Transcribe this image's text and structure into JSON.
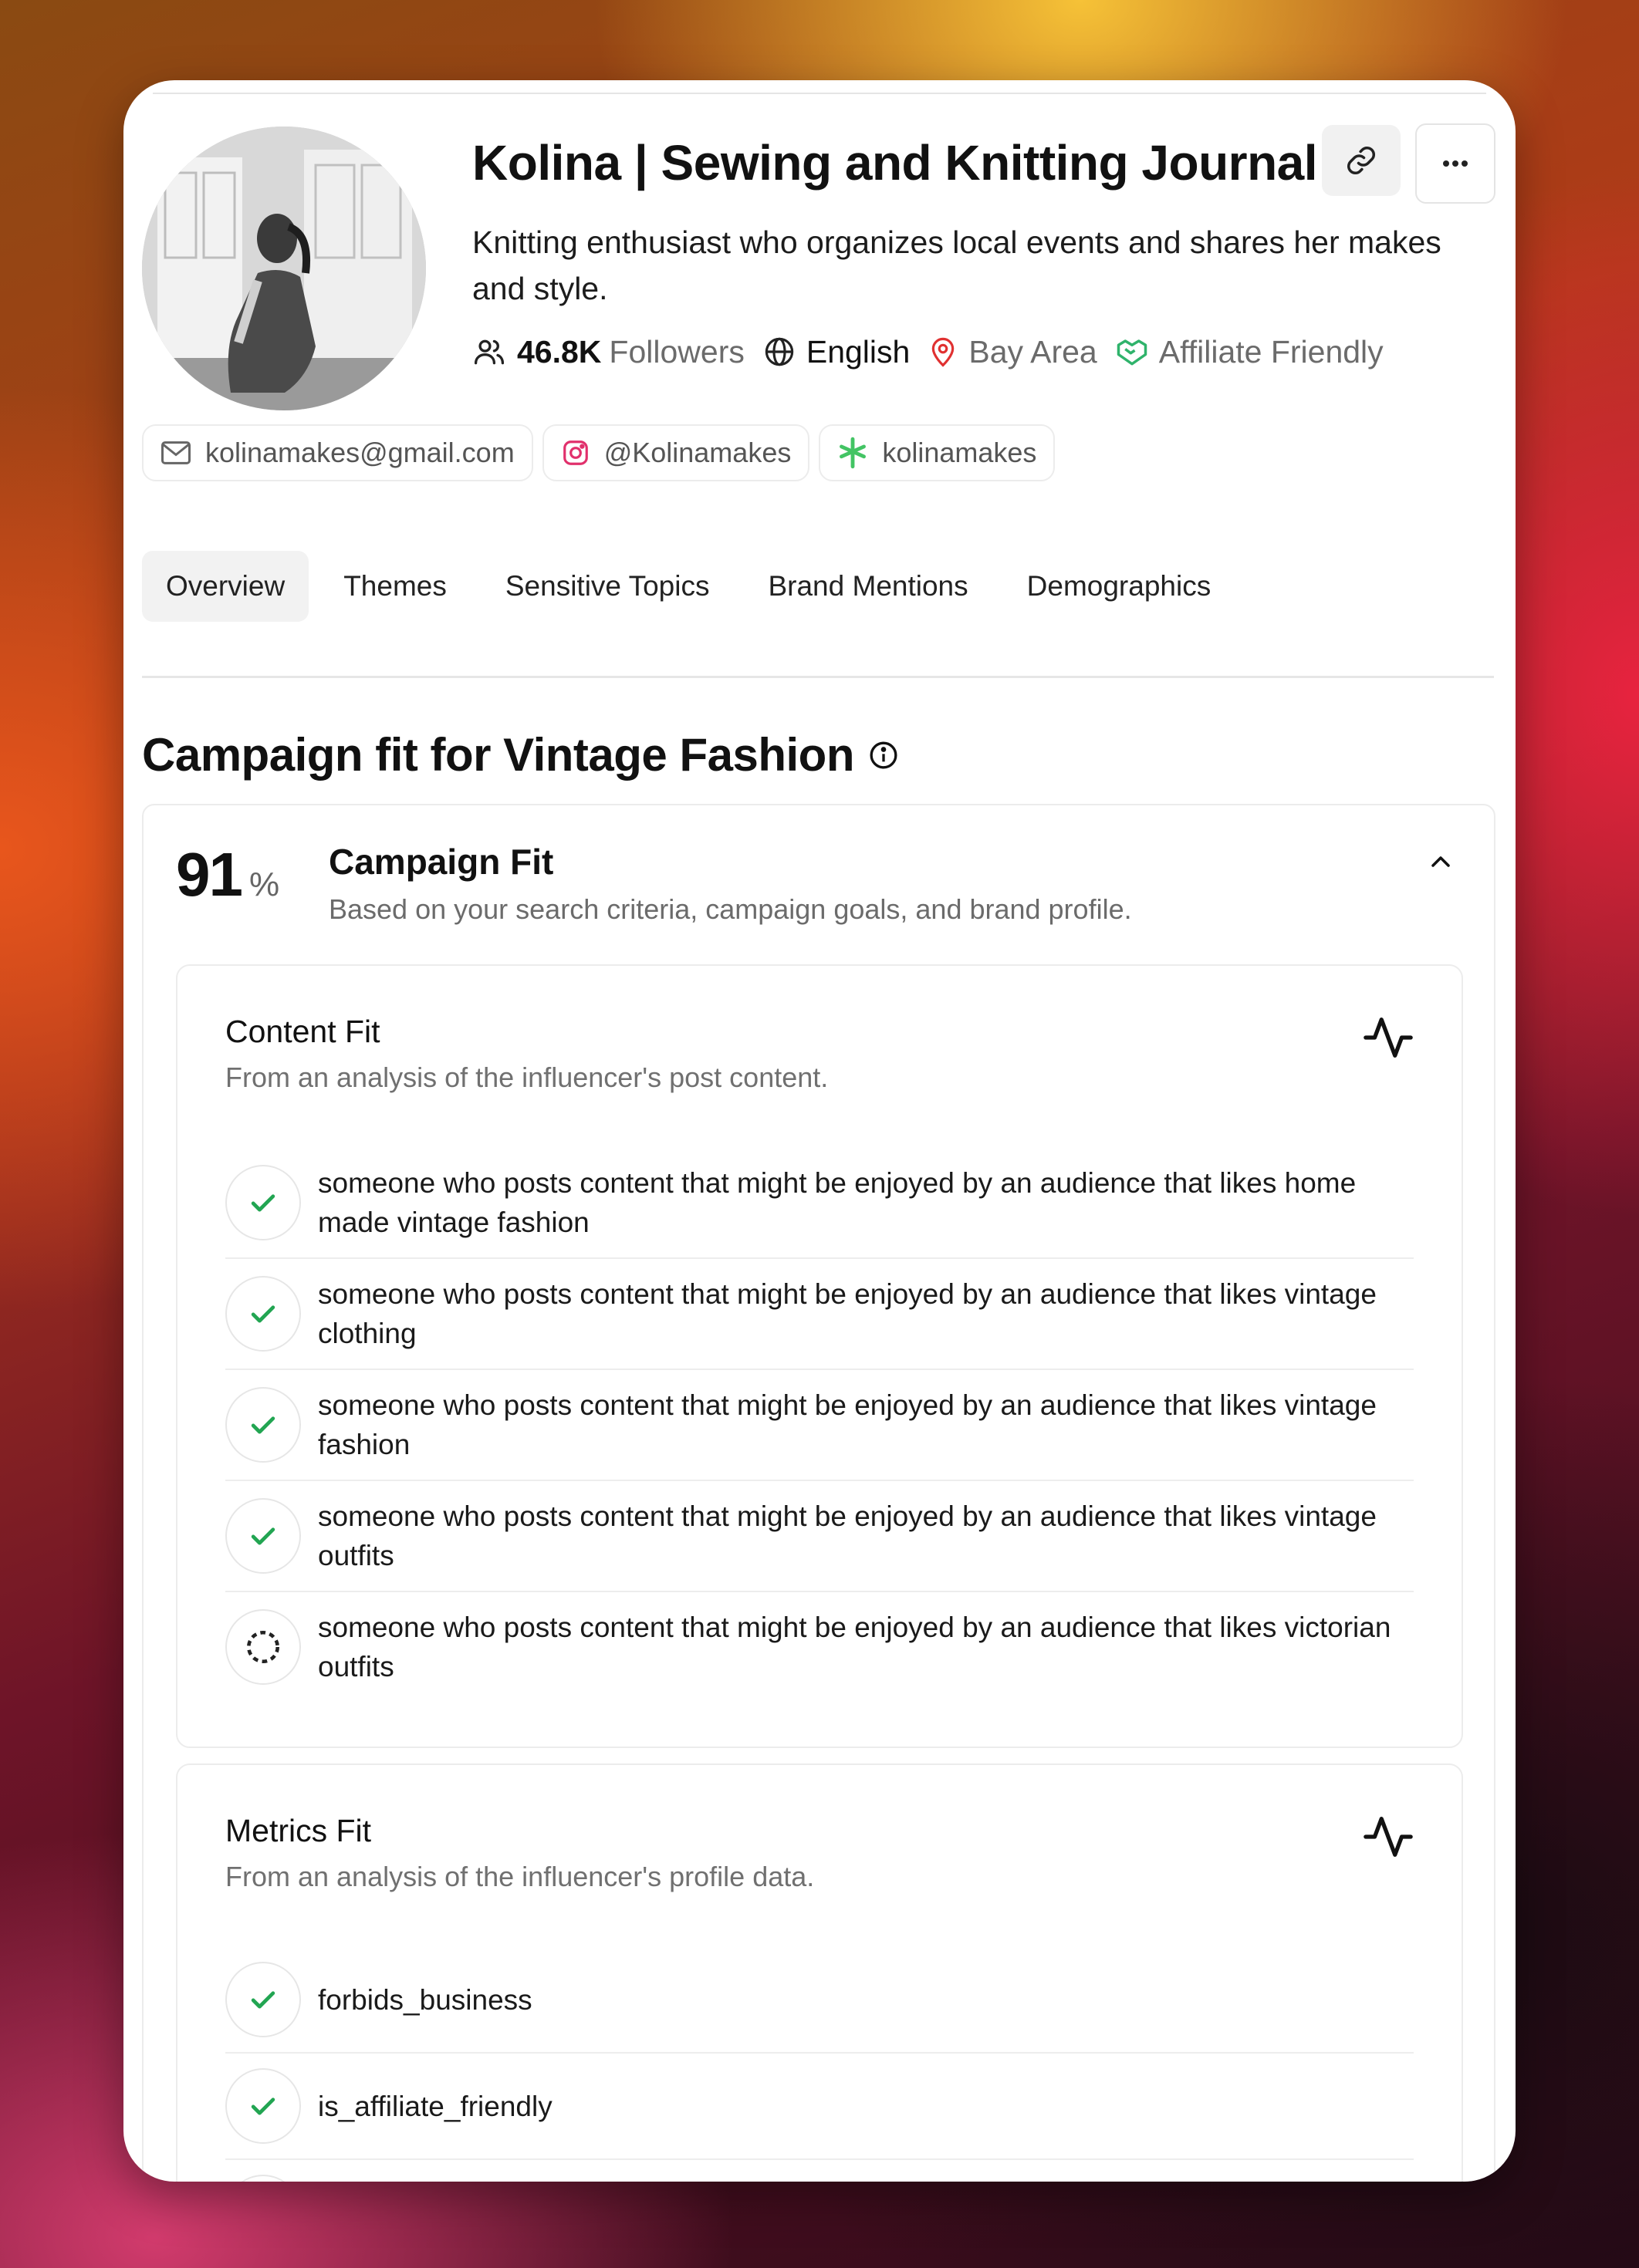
{
  "profile": {
    "name": "Kolina | Sewing and Knitting Journal",
    "bio": "Knitting enthusiast who organizes local events and shares her makes and style.",
    "followers_count": "46.8K",
    "followers_label": "Followers",
    "language": "English",
    "location": "Bay Area",
    "affiliate": "Affiliate Friendly"
  },
  "contacts": {
    "email": "kolinamakes@gmail.com",
    "instagram": "@Kolinamakes",
    "linktree": "kolinamakes"
  },
  "tabs": [
    "Overview",
    "Themes",
    "Sensitive Topics",
    "Brand Mentions",
    "Demographics"
  ],
  "campaign": {
    "section_title": "Campaign fit for Vintage Fashion",
    "score": "91",
    "score_unit": "%",
    "heading": "Campaign Fit",
    "subheading": "Based on your search criteria, campaign goals, and brand profile."
  },
  "content_fit": {
    "title": "Content Fit",
    "subtitle": "From an analysis of the influencer's post content.",
    "items": [
      {
        "text": "someone who posts content that might be enjoyed by an audience that likes home made vintage fashion",
        "status": "check"
      },
      {
        "text": "someone who posts content that might be enjoyed by an audience that likes vintage clothing",
        "status": "check"
      },
      {
        "text": "someone who posts content that might be enjoyed by an audience that likes vintage fashion",
        "status": "check"
      },
      {
        "text": "someone who posts content that might be enjoyed by an audience that likes vintage outfits",
        "status": "check"
      },
      {
        "text": "someone who posts content that might be enjoyed by an audience that likes victorian outfits",
        "status": "pending"
      }
    ]
  },
  "metrics_fit": {
    "title": "Metrics Fit",
    "subtitle": "From an analysis of the influencer's profile data.",
    "items": [
      {
        "text": "forbids_business",
        "status": "check"
      },
      {
        "text": "is_affiliate_friendly",
        "status": "check"
      }
    ]
  },
  "colors": {
    "check": "#22a552",
    "location_icon": "#e03131",
    "affiliate_icon": "#2fb36b",
    "instagram_icon": "#e1306c",
    "linktree_icon": "#43c464"
  }
}
